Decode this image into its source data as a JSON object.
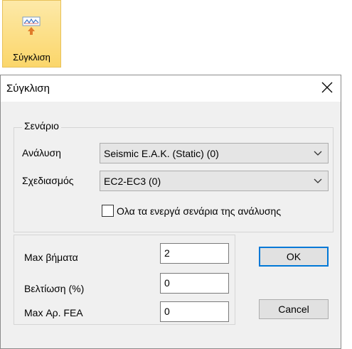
{
  "ribbon": {
    "label": "Σύγκλιση",
    "icon": "convergence-chart-icon"
  },
  "dialog": {
    "title": "Σύγκλιση",
    "close_icon": "close-icon",
    "scenario_group": {
      "legend": "Σενάριο",
      "analysis_label": "Ανάλυση",
      "analysis_value": "Seismic E.A.K. (Static) (0)",
      "design_label": "Σχεδιασμός",
      "design_value": "EC2-EC3  (0)",
      "all_scenarios_label": "Ολα τα ενεργά σενάρια της ανάλυσης",
      "all_scenarios_checked": false
    },
    "params": {
      "max_steps_label": "Max βήματα",
      "max_steps_value": "2",
      "improvement_label": "Βελτίωση (%)",
      "improvement_value": "0",
      "max_fea_label": "Max Αρ. FEA",
      "max_fea_value": "0"
    },
    "ok_label": "OK",
    "cancel_label": "Cancel"
  },
  "colors": {
    "ribbon_highlight": "#fbd66a",
    "default_button_border": "#0078d7",
    "dialog_bg": "#f0f0f0"
  }
}
